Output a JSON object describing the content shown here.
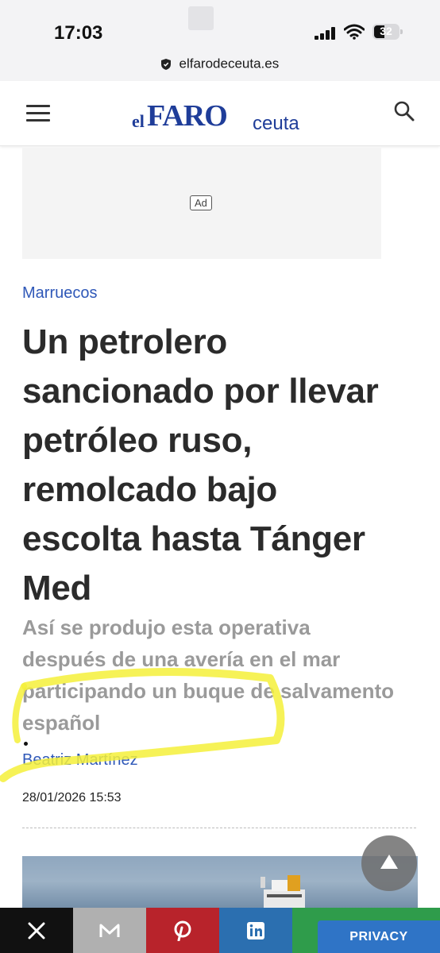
{
  "status_bar": {
    "time": "17:03",
    "battery_level": "32",
    "icons": [
      "signal-icon",
      "wifi-icon",
      "battery-icon"
    ]
  },
  "browser": {
    "url": "elfarodeceuta.es"
  },
  "site_header": {
    "logo": {
      "el": "el",
      "faro": "FARO",
      "ceuta": "ceuta"
    },
    "brand_color": "#1f3d99"
  },
  "ad": {
    "label": "Ad"
  },
  "article": {
    "category": "Marruecos",
    "headline": "Un petrolero sancionado por llevar petróleo ruso, remolcado bajo escolta hasta Tánger Med",
    "subheadline": "Así se produjo esta operativa después de una avería en el mar participando un buque de salvamento español",
    "author": "Beatriz Martínez",
    "date": "28/01/2026 15:53",
    "link_color": "#2f58b8"
  },
  "share_bar": {
    "buttons": [
      {
        "name": "x",
        "icon": "x-icon",
        "color": "#111111"
      },
      {
        "name": "email",
        "icon": "email-icon",
        "color": "#b0b0b0"
      },
      {
        "name": "pinterest",
        "icon": "pinterest-icon",
        "color": "#b8232b"
      },
      {
        "name": "linkedin",
        "icon": "linkedin-icon",
        "color": "#2b6fb0"
      },
      {
        "name": "whatsapp",
        "icon": "whatsapp-icon",
        "color": "#2f9c4b"
      }
    ],
    "privacy_label": "PRIVACY"
  },
  "highlight_color": "#f4f03a"
}
